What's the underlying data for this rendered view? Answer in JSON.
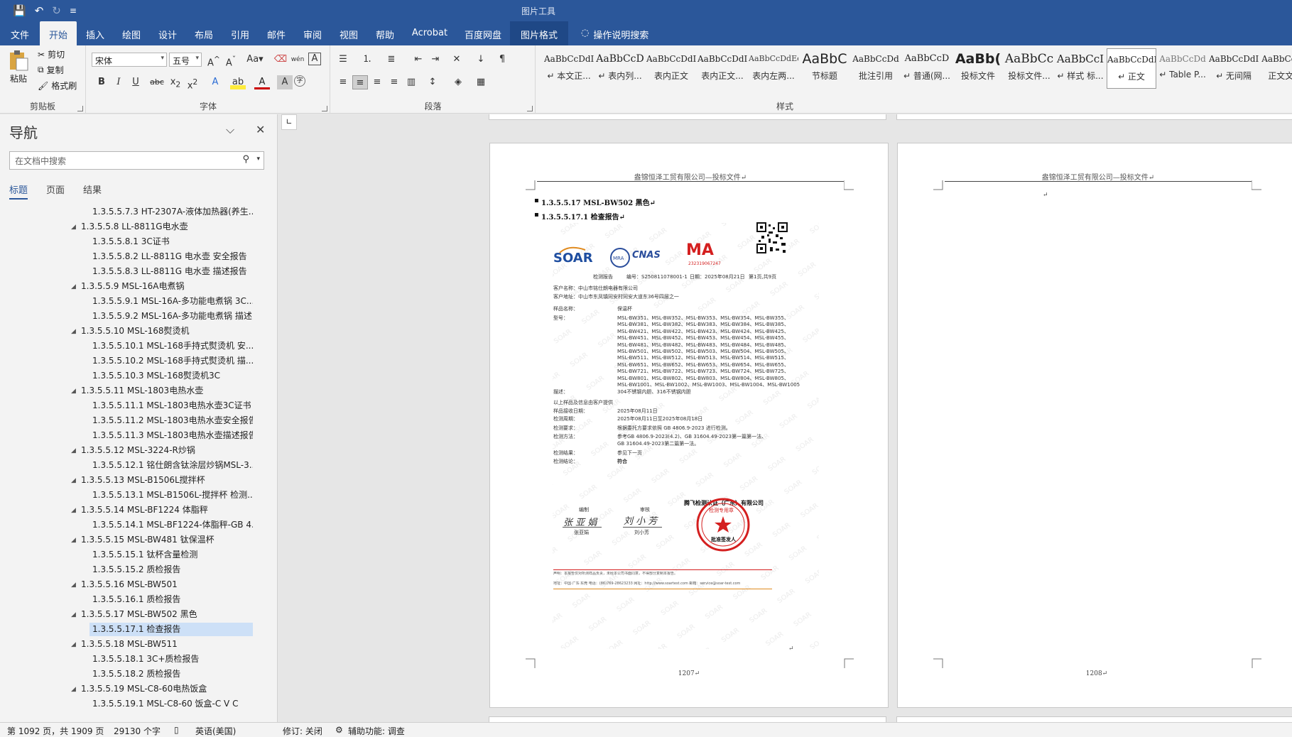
{
  "titlebar": {
    "contextual_title": "图片工具",
    "qat_save": "💾",
    "qat_undo": "↶",
    "qat_redo": "↻",
    "qat_more": "≡"
  },
  "tabs": [
    "文件",
    "开始",
    "插入",
    "绘图",
    "设计",
    "布局",
    "引用",
    "邮件",
    "审阅",
    "视图",
    "帮助",
    "Acrobat",
    "百度网盘",
    "图片格式"
  ],
  "active_tab": "开始",
  "tell_me": "操作说明搜索",
  "ribbon": {
    "clipboard": {
      "paste": "粘贴",
      "cut": "剪切",
      "copy": "复制",
      "format_painter": "格式刷",
      "label": "剪贴板"
    },
    "font": {
      "name": "宋体",
      "size": "五号",
      "label": "字体"
    },
    "paragraph": {
      "label": "段落"
    },
    "styles": {
      "label": "样式",
      "items": [
        {
          "preview": "AaBbCcDdI",
          "name": "↵ 本文正..."
        },
        {
          "preview": "AaBbCcD",
          "name": "↵ 表内列..."
        },
        {
          "preview": "AaBbCcDdI",
          "name": "表内正文"
        },
        {
          "preview": "AaBbCcDdI",
          "name": "表内正文..."
        },
        {
          "preview": "AaBbCcDdEe",
          "name": "表内左两..."
        },
        {
          "preview": "AaBbC",
          "name": "节标题"
        },
        {
          "preview": "AaBbCcDd",
          "name": "批注引用"
        },
        {
          "preview": "AaBbCcD",
          "name": "↵ 普通(网..."
        },
        {
          "preview": "AaBb(",
          "name": "投标文件"
        },
        {
          "preview": "AaBbCc",
          "name": "投标文件..."
        },
        {
          "preview": "AaBbCcI",
          "name": "↵ 样式 标..."
        },
        {
          "preview": "AaBbCcDdI",
          "name": "↵ 正文"
        },
        {
          "preview": "AaBbCcDd",
          "name": "↵ Table P..."
        },
        {
          "preview": "AaBbCcDdI",
          "name": "↵ 无间隔"
        },
        {
          "preview": "AaBbCcDd",
          "name": "正文文..."
        }
      ],
      "selected_index": 11
    }
  },
  "nav": {
    "title": "导航",
    "search_placeholder": "在文档中搜索",
    "tabs": [
      "标题",
      "页面",
      "结果"
    ],
    "active_tab": "标题",
    "headings": [
      {
        "text": "1.3.5.5.7.3 HT-2307A-液体加热器(养生...",
        "level": 2,
        "caret": false
      },
      {
        "text": "1.3.5.5.8 LL-8811G电水壶",
        "level": 1,
        "caret": true
      },
      {
        "text": "1.3.5.5.8.1 3C证书",
        "level": 2,
        "caret": false
      },
      {
        "text": "1.3.5.5.8.2 LL-8811G 电水壶  安全报告",
        "level": 2,
        "caret": false
      },
      {
        "text": "1.3.5.5.8.3 LL-8811G 电水壶  描述报告",
        "level": 2,
        "caret": false
      },
      {
        "text": "1.3.5.5.9 MSL-16A电煮锅",
        "level": 1,
        "caret": true
      },
      {
        "text": "1.3.5.5.9.1 MSL-16A-多功能电煮锅 3C...",
        "level": 2,
        "caret": false
      },
      {
        "text": "1.3.5.5.9.2 MSL-16A-多功能电煮锅 描述...",
        "level": 2,
        "caret": false
      },
      {
        "text": "1.3.5.5.10 MSL-168熨烫机",
        "level": 1,
        "caret": true
      },
      {
        "text": "1.3.5.5.10.1 MSL-168手持式熨烫机 安...",
        "level": 2,
        "caret": false
      },
      {
        "text": "1.3.5.5.10.2 MSL-168手持式熨烫机 描...",
        "level": 2,
        "caret": false
      },
      {
        "text": "1.3.5.5.10.3 MSL-168熨烫机3C",
        "level": 2,
        "caret": false
      },
      {
        "text": "1.3.5.5.11 MSL-1803电热水壶",
        "level": 1,
        "caret": true
      },
      {
        "text": "1.3.5.5.11.1 MSL-1803电热水壶3C证书",
        "level": 2,
        "caret": false
      },
      {
        "text": "1.3.5.5.11.2 MSL-1803电热水壶安全报告",
        "level": 2,
        "caret": false
      },
      {
        "text": "1.3.5.5.11.3 MSL-1803电热水壶描述报告",
        "level": 2,
        "caret": false
      },
      {
        "text": "1.3.5.5.12 MSL-3224-R炒锅",
        "level": 1,
        "caret": true
      },
      {
        "text": "1.3.5.5.12.1 铭仕朗含钛涂层炒锅MSL-3...",
        "level": 2,
        "caret": false
      },
      {
        "text": "1.3.5.5.13 MSL-B1506L搅拌杯",
        "level": 1,
        "caret": true
      },
      {
        "text": "1.3.5.5.13.1 MSL-B1506L-搅拌杯 检测...",
        "level": 2,
        "caret": false
      },
      {
        "text": "1.3.5.5.14 MSL-BF1224 体脂秤",
        "level": 1,
        "caret": true
      },
      {
        "text": "1.3.5.5.14.1 MSL-BF1224-体脂秤-GB 4...",
        "level": 2,
        "caret": false
      },
      {
        "text": "1.3.5.5.15 MSL-BW481 钛保温杯",
        "level": 1,
        "caret": true
      },
      {
        "text": "1.3.5.5.15.1 钛杯含量检测",
        "level": 2,
        "caret": false
      },
      {
        "text": "1.3.5.5.15.2 质检报告",
        "level": 2,
        "caret": false
      },
      {
        "text": "1.3.5.5.16 MSL-BW501",
        "level": 1,
        "caret": true
      },
      {
        "text": "1.3.5.5.16.1 质检报告",
        "level": 2,
        "caret": false
      },
      {
        "text": "1.3.5.5.17 MSL-BW502 黑色",
        "level": 1,
        "caret": true
      },
      {
        "text": "1.3.5.5.17.1 检查报告",
        "level": 2,
        "caret": false
      },
      {
        "text": "1.3.5.5.18 MSL-BW511",
        "level": 1,
        "caret": true
      },
      {
        "text": "1.3.5.5.18.1 3C+质检报告",
        "level": 2,
        "caret": false
      },
      {
        "text": "1.3.5.5.18.2 质检报告",
        "level": 2,
        "caret": false
      },
      {
        "text": "1.3.5.5.19 MSL-C8-60电热饭盒",
        "level": 1,
        "caret": true
      },
      {
        "text": "1.3.5.5.19.1 MSL-C8-60 饭盒-C V C",
        "level": 2,
        "caret": false
      }
    ],
    "selected_index": 28
  },
  "document": {
    "header_text": "盎锦恒泽工贸有限公司—投标文件↵",
    "heading1": "1.3.5.5.17 MSL-BW502  黑色↵",
    "heading2": "1.3.5.5.17.1   检查报告↵",
    "page_left": "1207↵",
    "page_right": "1208↵",
    "empty_para": "↵",
    "report": {
      "logo": "SOAR",
      "cnas": "CNAS",
      "ma": "MA",
      "ma_num": "232319067247",
      "report_label": "检测报告",
      "report_no": "编号：S250811078001-1",
      "date": "日期：2025年08月21日",
      "page": "第1页,共9页",
      "client": "客户名称：中山市铭仕朗电器有限公司",
      "address": "客户地址：中山市东凤镇同安村同安大道东36号四层之一",
      "sample_label": "样品名称：",
      "sample": "保温杯",
      "model_label": "型号：",
      "models": [
        "MSL-BW351、MSL-BW352、MSL-BW353、MSL-BW354、MSL-BW355、",
        "MSL-BW381、MSL-BW382、MSL-BW383、MSL-BW384、MSL-BW385、",
        "MSL-BW421、MSL-BW422、MSL-BW423、MSL-BW424、MSL-BW425、",
        "MSL-BW451、MSL-BW452、MSL-BW453、MSL-BW454、MSL-BW455、",
        "MSL-BW481、MSL-BW482、MSL-BW483、MSL-BW484、MSL-BW485、",
        "MSL-BW501、MSL-BW502、MSL-BW503、MSL-BW504、MSL-BW505、",
        "MSL-BW511、MSL-BW512、MSL-BW513、MSL-BW514、MSL-BW515、",
        "MSL-BW651、MSL-BW652、MSL-BW653、MSL-BW654、MSL-BW655、",
        "MSL-BW721、MSL-BW722、MSL-BW723、MSL-BW724、MSL-BW725、",
        "MSL-BW801、MSL-BW802、MSL-BW803、MSL-BW804、MSL-BW805、",
        "MSL-BW1001、MSL-BW1002、MSL-BW1003、MSL-BW1004、MSL-BW1005"
      ],
      "desc_label": "描述：",
      "desc": "304不锈钢内胆、316不锈钢内胆",
      "note": "以上样品及信息由客户提供",
      "recv_label": "样品接收日期：",
      "recv": "2025年08月11日",
      "period_label": "检测周期：",
      "period": "2025年08月11日至2025年08月18日",
      "req_label": "检测要求：",
      "req": "根据委托方要求依照 GB 4806.9-2023 进行检测。",
      "method_label": "检测方法：",
      "method1": "参考GB 4806.9-2023(4.2)、GB 31604.49-2023第一篇第一法、",
      "method2": "GB 31604.49-2023第二篇第一法。",
      "result_label": "检测结果：",
      "result": "参见下一页",
      "concl_label": "检测结论：",
      "concl": "符合",
      "company": "腾飞检测认证（广东）有限公司",
      "seal_text": "检测专用章",
      "editor_label": "编制",
      "reviewer_label": "审核",
      "editor_sig": "张 亚 娟",
      "reviewer_sig": "刘 小 芳",
      "editor_name": "张亚娟",
      "reviewer_name": "刘小芳",
      "approver": "批准签发人",
      "footer1": "声明：本报告仅对所测样品负责，未经本公司书面同意，不得部分复制本报告。",
      "footer2": "地址：中国·广东·东莞    电话：(86)769-28623233    网址：http://www.soartest.com    邮箱：service@soar-test.com"
    }
  },
  "status": {
    "page": "第 1092 页，共 1909 页",
    "words": "29130 个字",
    "lang": "英语(美国)",
    "track": "修订: 关闭",
    "access": "辅助功能: 调查"
  }
}
